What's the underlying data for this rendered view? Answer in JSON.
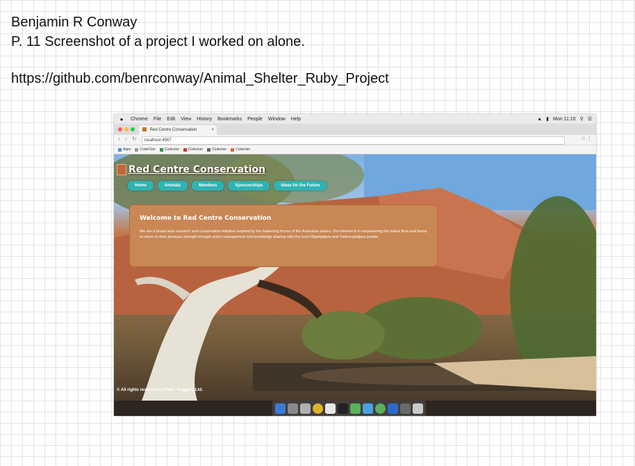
{
  "note": {
    "line1": "Benjamin R Conway",
    "line2": "P. 11 Screenshot of a project I worked on alone.",
    "line3": "https://github.com/benrconway/Animal_Shelter_Ruby_Project"
  },
  "menubar": {
    "items": [
      "Chrome",
      "File",
      "Edit",
      "View",
      "History",
      "Bookmarks",
      "People",
      "Window",
      "Help"
    ],
    "clock": "Mon 11:10"
  },
  "browser": {
    "tab_title": "Red Centre Conservation",
    "url": "localhost:4567",
    "bookmarks": [
      "Apps",
      "CodeClan",
      "Codeclan",
      "Codeclan",
      "Codeclan",
      "Codeclan"
    ]
  },
  "site": {
    "title": "Red Centre Conservation",
    "nav": [
      "Home",
      "Animals",
      "Members",
      "Sponsorships",
      "Ideas for the Future"
    ],
    "welcome_heading": "Welcome to Red Centre Conservation",
    "welcome_text": "We are a broad area research and conservation initiative inspired by the balancing forces of the Australian nature. Our interest is in empowering the native flora and fauna to return to their previous strength through active management and knowledge sharing with the local Pitjantjatjara and Yankunytjatjara people.",
    "footer": "© All rights reserved by Free - Rugging Ltd."
  },
  "colors": {
    "accent_teal": "#2fb3b3",
    "panel_orange": "#c98755"
  }
}
